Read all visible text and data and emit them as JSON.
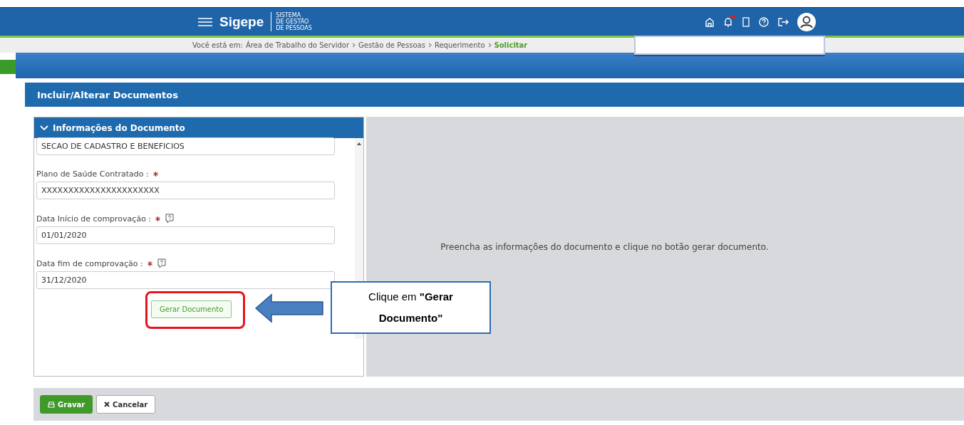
{
  "header": {
    "logo": "Sigepe",
    "logo_subtitle": [
      "SISTEMA",
      "DE GESTÃO",
      "DE PESSOAS"
    ],
    "notification_unread": true
  },
  "breadcrumb": {
    "prefix": "Você está em:",
    "items": [
      {
        "label": "Área de Trabalho do Servidor",
        "current": false
      },
      {
        "label": "Gestão de Pessoas",
        "current": false
      },
      {
        "label": "Requerimento",
        "current": false
      },
      {
        "label": "Solicitar",
        "current": true
      }
    ]
  },
  "section_title": "Incluir/Alterar Documentos",
  "panel": {
    "title": "Informações do Documento",
    "expanded": true,
    "fields": [
      {
        "value": "SECAO DE CADASTRO E BENEFICIOS"
      },
      {
        "label": "Plano de Saúde Contratado :",
        "value": "XXXXXXXXXXXXXXXXXXXXXX",
        "required": true,
        "help": false
      },
      {
        "label": "Data Início de comprovação :",
        "value": "01/01/2020",
        "required": true,
        "help": true
      },
      {
        "label": "Data fim de comprovação :",
        "value": "31/12/2020",
        "required": true,
        "help": true
      }
    ],
    "generate_button": "Gerar Documento"
  },
  "preview_message": "Preencha as informações do documento e clique no botão gerar documento.",
  "callout": "Clique em **\"Gerar Documento\"**",
  "footer_buttons": [
    {
      "label": "Gravar",
      "kind": "primary"
    },
    {
      "label": "Cancelar",
      "kind": "secondary"
    }
  ]
}
